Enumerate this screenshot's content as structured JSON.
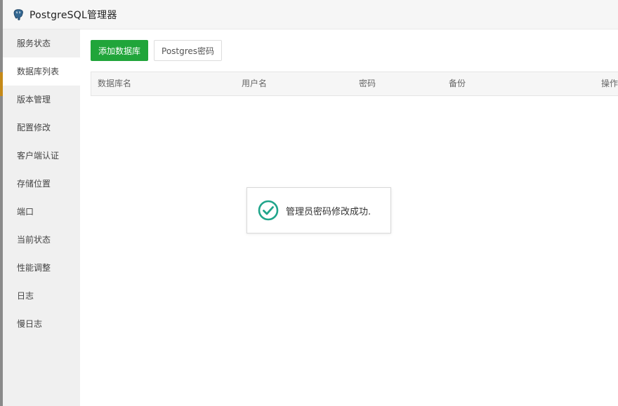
{
  "app": {
    "title": "PostgreSQL管理器",
    "logo_icon": "postgresql-elephant-icon"
  },
  "colors": {
    "accent": "#20a53a",
    "success_icon": "#20a58b"
  },
  "sidebar": {
    "active_index": 1,
    "items": [
      {
        "label": "服务状态"
      },
      {
        "label": "数据库列表"
      },
      {
        "label": "版本管理"
      },
      {
        "label": "配置修改"
      },
      {
        "label": "客户端认证"
      },
      {
        "label": "存储位置"
      },
      {
        "label": "端口"
      },
      {
        "label": "当前状态"
      },
      {
        "label": "性能调整"
      },
      {
        "label": "日志"
      },
      {
        "label": "慢日志"
      }
    ]
  },
  "toolbar": {
    "add_db_label": "添加数据库",
    "pg_password_label": "Postgres密码"
  },
  "table": {
    "columns": [
      "数据库名",
      "用户名",
      "密码",
      "备份",
      "操作"
    ],
    "rows": []
  },
  "toast": {
    "icon": "check-circle-icon",
    "message": "管理员密码修改成功."
  }
}
